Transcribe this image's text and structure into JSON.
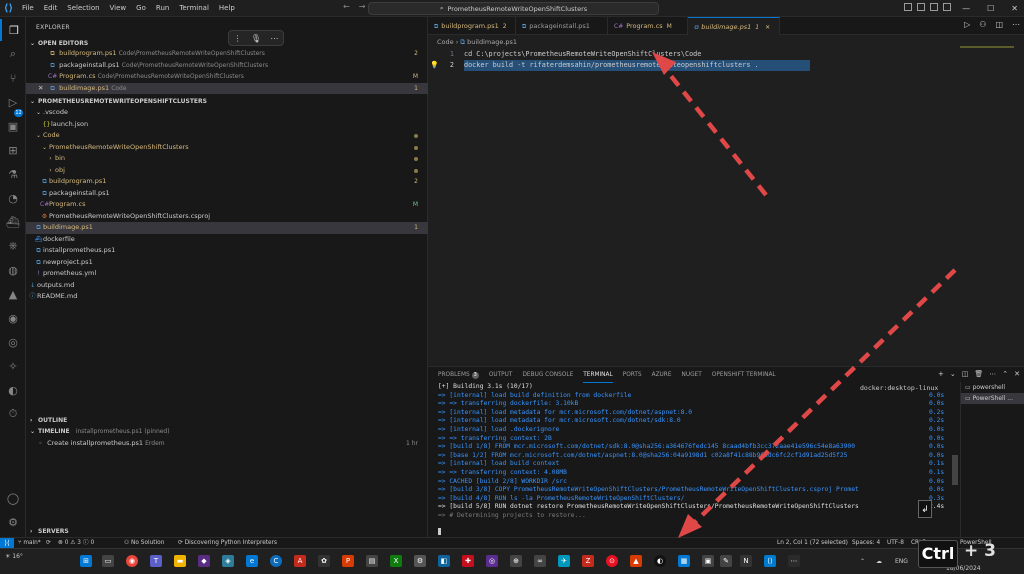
{
  "window": {
    "title": "PrometheusRemoteWriteOpenShiftClusters",
    "menu": [
      "File",
      "Edit",
      "Selection",
      "View",
      "Go",
      "Run",
      "Terminal",
      "Help"
    ]
  },
  "explorer": {
    "header": "EXPLORER",
    "open_editors": {
      "title": "OPEN EDITORS",
      "items": [
        {
          "name": "buildprogram.ps1",
          "path": "Code\\PrometheusRemoteWriteOpenShiftClusters",
          "status": "2"
        },
        {
          "name": "packageinstall.ps1",
          "path": "Code\\PrometheusRemoteWriteOpenShiftClusters",
          "status": ""
        },
        {
          "name": "Program.cs",
          "path": "Code\\PrometheusRemoteWriteOpenShiftClusters",
          "status": "M"
        },
        {
          "name": "buildimage.ps1",
          "path": "Code",
          "status": "1"
        }
      ]
    },
    "project": {
      "title": "PROMETHEUSREMOTEWRITEOPENSHIFTCLUSTERS",
      "items": [
        {
          "name": ".vscode",
          "status": ""
        },
        {
          "name": "launch.json",
          "status": ""
        },
        {
          "name": "Code",
          "status": ""
        },
        {
          "name": "PrometheusRemoteWriteOpenShiftClusters",
          "status": ""
        },
        {
          "name": "bin",
          "status": ""
        },
        {
          "name": "obj",
          "status": ""
        },
        {
          "name": "buildprogram.ps1",
          "status": "2"
        },
        {
          "name": "packageinstall.ps1",
          "status": ""
        },
        {
          "name": "Program.cs",
          "status": "M"
        },
        {
          "name": "PrometheusRemoteWriteOpenShiftClusters.csproj",
          "status": ""
        },
        {
          "name": "buildimage.ps1",
          "status": "1"
        },
        {
          "name": "dockerfile",
          "status": ""
        },
        {
          "name": "installprometheus.ps1",
          "status": ""
        },
        {
          "name": "newproject.ps1",
          "status": ""
        },
        {
          "name": "prometheus.yml",
          "status": ""
        },
        {
          "name": "outputs.md",
          "status": ""
        },
        {
          "name": "README.md",
          "status": ""
        }
      ]
    },
    "outline": "OUTLINE",
    "timeline": {
      "title": "TIMELINE",
      "subtitle": "installprometheus.ps1 (pinned)",
      "entry": "Create installprometheus.ps1",
      "author": "Erdem",
      "time": "1 hr"
    },
    "servers": "SERVERS"
  },
  "tabs": [
    {
      "name": "buildprogram.ps1",
      "mark": "2"
    },
    {
      "name": "packageinstall.ps1",
      "mark": ""
    },
    {
      "name": "Program.cs",
      "mark": "M"
    },
    {
      "name": "buildimage.ps1",
      "mark": "1"
    }
  ],
  "breadcrumb": {
    "folder": "Code",
    "file": "buildimage.ps1"
  },
  "code": [
    "cd C:\\projects\\PrometheusRemoteWriteOpenShiftClusters\\Code",
    "docker build -t rifaterdemsahin/prometheusremotewriteopenshiftclusters ."
  ],
  "panel": {
    "tabs": [
      "PROBLEMS",
      "OUTPUT",
      "DEBUG CONSOLE",
      "TERMINAL",
      "PORTS",
      "AZURE",
      "NUGET",
      "OPENSHIFT TERMINAL"
    ],
    "problems_count": "3",
    "docker_context": "docker:desktop-linux",
    "terminals": [
      "powershell",
      "PowerShell ..."
    ],
    "lines": [
      {
        "text": "[+] Building 3.1s (10/17)",
        "time": "",
        "kind": "white"
      },
      {
        "text": " => [internal] load build definition from dockerfile",
        "time": "0.0s",
        "kind": "blue"
      },
      {
        "text": " => => transferring dockerfile: 3.10kB",
        "time": "0.0s",
        "kind": "blue"
      },
      {
        "text": " => [internal] load metadata for mcr.microsoft.com/dotnet/aspnet:8.0",
        "time": "0.2s",
        "kind": "blue"
      },
      {
        "text": " => [internal] load metadata for mcr.microsoft.com/dotnet/sdk:8.0",
        "time": "0.2s",
        "kind": "blue"
      },
      {
        "text": " => [internal] load .dockerignore",
        "time": "0.0s",
        "kind": "blue"
      },
      {
        "text": " => => transferring context: 2B",
        "time": "0.0s",
        "kind": "blue"
      },
      {
        "text": " => [build 1/8] FROM mcr.microsoft.com/dotnet/sdk:8.0@sha256:a364676fedc145   8caad4bfb3cc372aae41e596c54e8a63900",
        "time": "0.0s",
        "kind": "blue"
      },
      {
        "text": " => [base 1/2] FROM mcr.microsoft.com/dotnet/aspnet:8.0@sha256:04a9198d1   c02a8f41c88b96adc6fc2cf1d91ad25d5f25",
        "time": "0.0s",
        "kind": "blue"
      },
      {
        "text": " => [internal] load build context",
        "time": "0.1s",
        "kind": "blue"
      },
      {
        "text": " => => transferring context: 4.08MB",
        "time": "0.1s",
        "kind": "blue"
      },
      {
        "text": " => CACHED [build 2/8] WORKDIR /src",
        "time": "0.0s",
        "kind": "blue"
      },
      {
        "text": " => [build 3/8] COPY PrometheusRemoteWriteOpenShiftClusters/PrometheusRemoteWriteOpenShiftClusters.csproj Promet",
        "time": "0.0s",
        "kind": "blue"
      },
      {
        "text": " => [build 4/8] RUN ls -la PrometheusRemoteWriteOpenShiftClusters/",
        "time": "0.3s",
        "kind": "blue"
      },
      {
        "text": " => [build 5/8] RUN dotnet restore PrometheusRemoteWriteOpenShiftClusters/PrometheusRemoteWriteOpenShiftClusters",
        "time": "2.4s",
        "kind": "white"
      },
      {
        "text": " => #    Determining projects to restore...",
        "time": "",
        "kind": "gray"
      }
    ]
  },
  "statusbar": {
    "branch": "main*",
    "errors": "0",
    "warnings": "3",
    "info": "0",
    "solution": "No Solution",
    "python": "Discovering Python Interpreters",
    "position": "Ln 2, Col 1 (72 selected)",
    "spaces": "Spaces: 4",
    "encoding": "UTF-8",
    "eol": "CRLF",
    "lang": "PowerShell"
  },
  "taskbar": {
    "weather": "16°",
    "lang": "ENG",
    "date": "18/06/2024"
  },
  "overlay": {
    "ctrl_key": "Ctrl",
    "plus_text": "+ 3"
  },
  "colors": {
    "accent": "#0078d4",
    "selection": "#264f78",
    "arrow": "#e04848"
  }
}
